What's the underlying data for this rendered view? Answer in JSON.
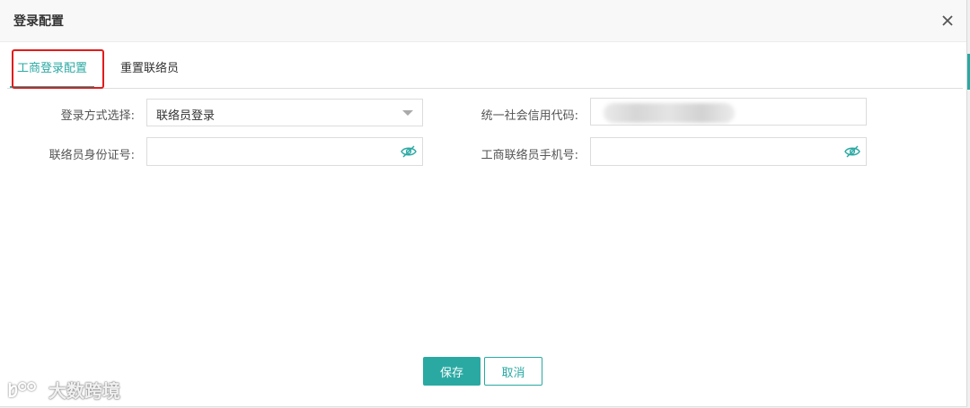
{
  "dialog": {
    "title": "登录配置",
    "close_icon": "close-icon"
  },
  "tabs": [
    {
      "label": "工商登录配置",
      "active": true
    },
    {
      "label": "重置联络员",
      "active": false
    }
  ],
  "form": {
    "login_method": {
      "label": "登录方式选择:",
      "value": "联络员登录"
    },
    "credit_code": {
      "label": "统一社会信用代码:",
      "value": ""
    },
    "contact_id": {
      "label": "联络员身份证号:",
      "value": ""
    },
    "contact_phone": {
      "label": "工商联络员手机号:",
      "value": ""
    }
  },
  "actions": {
    "save_label": "保存",
    "cancel_label": "取消"
  },
  "watermark": {
    "text": "大数跨境"
  },
  "colors": {
    "accent": "#2aa9a3",
    "highlight": "#e21b1b"
  }
}
